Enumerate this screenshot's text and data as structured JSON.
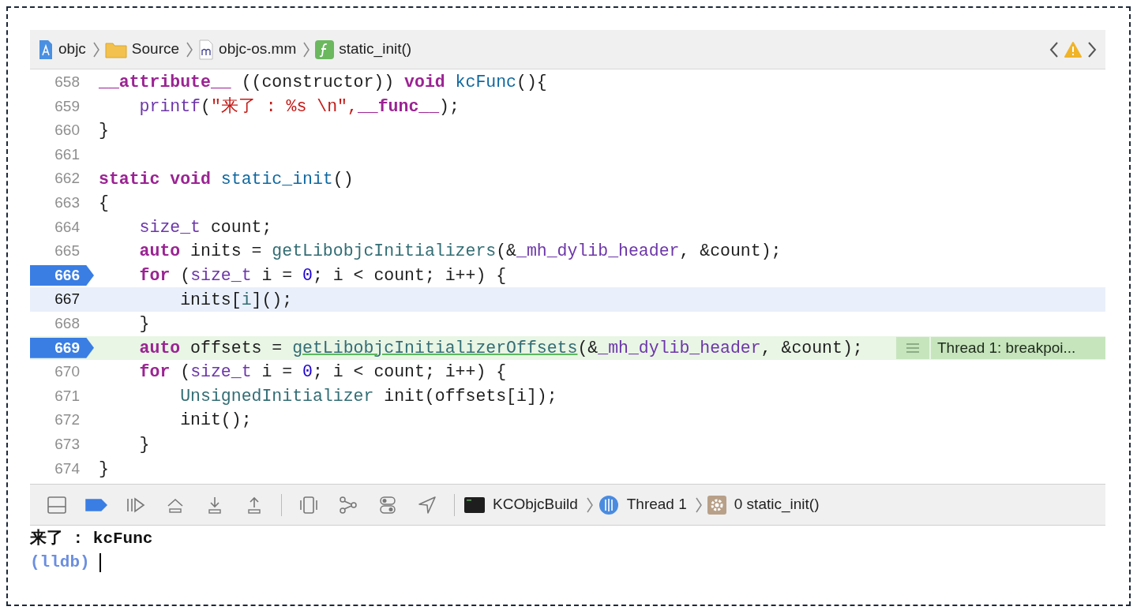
{
  "breadcrumbs": [
    {
      "kind": "project",
      "label": "objc"
    },
    {
      "kind": "folder",
      "label": "Source"
    },
    {
      "kind": "file",
      "label": "objc-os.mm"
    },
    {
      "kind": "function",
      "label": "static_init()"
    }
  ],
  "editor": {
    "lines": [
      {
        "number": "658",
        "breakpoint": false,
        "current": false,
        "cursor": false,
        "tokens": [
          {
            "t": "__attribute__",
            "kind": "kw"
          },
          {
            "t": " ((constructor)) ",
            "kind": "plain"
          },
          {
            "t": "void",
            "kind": "kw"
          },
          {
            "t": " kcFunc",
            "kind": "decl"
          },
          {
            "t": "(){",
            "kind": "plain"
          }
        ]
      },
      {
        "number": "659",
        "breakpoint": false,
        "current": false,
        "cursor": false,
        "tokens": [
          {
            "t": "    printf",
            "kind": "sysfunc"
          },
          {
            "t": "(",
            "kind": "plain"
          },
          {
            "t": "\"来了 : %s \\n\",",
            "kind": "str"
          },
          {
            "t": "__func__",
            "kind": "kw"
          },
          {
            "t": ");",
            "kind": "plain"
          }
        ]
      },
      {
        "number": "660",
        "breakpoint": false,
        "current": false,
        "cursor": false,
        "tokens": [
          {
            "t": "}",
            "kind": "plain"
          }
        ]
      },
      {
        "number": "661",
        "breakpoint": false,
        "current": false,
        "cursor": false
      },
      {
        "number": "662",
        "breakpoint": false,
        "current": false,
        "cursor": false,
        "tokens": [
          {
            "t": "static void",
            "kind": "kw"
          },
          {
            "t": " static_init",
            "kind": "decl"
          },
          {
            "t": "()",
            "kind": "plain"
          }
        ]
      },
      {
        "number": "663",
        "breakpoint": false,
        "current": false,
        "cursor": false,
        "tokens": [
          {
            "t": "{",
            "kind": "plain"
          }
        ]
      },
      {
        "number": "664",
        "breakpoint": false,
        "current": false,
        "cursor": false,
        "tokens": [
          {
            "t": "    size_t",
            "kind": "type"
          },
          {
            "t": " count;",
            "kind": "plain"
          }
        ]
      },
      {
        "number": "665",
        "breakpoint": false,
        "current": false,
        "cursor": false,
        "tokens": [
          {
            "t": "    auto",
            "kind": "kw"
          },
          {
            "t": " inits = ",
            "kind": "plain"
          },
          {
            "t": "getLibobjcInitializers",
            "kind": "func"
          },
          {
            "t": "(&",
            "kind": "plain"
          },
          {
            "t": "_mh_dylib_header",
            "kind": "var"
          },
          {
            "t": ", &count);",
            "kind": "plain"
          }
        ]
      },
      {
        "number": "666",
        "breakpoint": true,
        "current": false,
        "cursor": false,
        "tokens": [
          {
            "t": "    for",
            "kind": "kw"
          },
          {
            "t": " (",
            "kind": "plain"
          },
          {
            "t": "size_t",
            "kind": "type"
          },
          {
            "t": " i = ",
            "kind": "plain"
          },
          {
            "t": "0",
            "kind": "num"
          },
          {
            "t": "; i < count; i++) {",
            "kind": "plain"
          }
        ]
      },
      {
        "number": "667",
        "breakpoint": false,
        "current": false,
        "cursor": true,
        "tokens": [
          {
            "t": "        inits[",
            "kind": "plain"
          },
          {
            "t": "i",
            "kind": "func"
          },
          {
            "t": "]();",
            "kind": "plain"
          }
        ]
      },
      {
        "number": "668",
        "breakpoint": false,
        "current": false,
        "cursor": false,
        "tokens": [
          {
            "t": "    }",
            "kind": "plain"
          }
        ]
      },
      {
        "number": "669",
        "breakpoint": true,
        "current": true,
        "cursor": false,
        "tokens": [
          {
            "t": "    auto",
            "kind": "kw"
          },
          {
            "t": " offsets = ",
            "kind": "plain"
          },
          {
            "t": "getLibobjcInitializerOffsets",
            "kind": "link"
          },
          {
            "t": "(&",
            "kind": "plain"
          },
          {
            "t": "_mh_dylib_header",
            "kind": "var"
          },
          {
            "t": ", &count);",
            "kind": "plain"
          }
        ],
        "annotation": "Thread 1: breakpoi..."
      },
      {
        "number": "670",
        "breakpoint": false,
        "current": false,
        "cursor": false,
        "tokens": [
          {
            "t": "    for",
            "kind": "kw"
          },
          {
            "t": " (",
            "kind": "plain"
          },
          {
            "t": "size_t",
            "kind": "type"
          },
          {
            "t": " i = ",
            "kind": "plain"
          },
          {
            "t": "0",
            "kind": "num"
          },
          {
            "t": "; i < count; i++) {",
            "kind": "plain"
          }
        ]
      },
      {
        "number": "671",
        "breakpoint": false,
        "current": false,
        "cursor": false,
        "tokens": [
          {
            "t": "        UnsignedInitializer",
            "kind": "func"
          },
          {
            "t": " init(offsets[i]);",
            "kind": "plain"
          }
        ]
      },
      {
        "number": "672",
        "breakpoint": false,
        "current": false,
        "cursor": false,
        "tokens": [
          {
            "t": "        init();",
            "kind": "plain"
          }
        ]
      },
      {
        "number": "673",
        "breakpoint": false,
        "current": false,
        "cursor": false,
        "tokens": [
          {
            "t": "    }",
            "kind": "plain"
          }
        ]
      },
      {
        "number": "674",
        "breakpoint": false,
        "current": false,
        "cursor": false,
        "tokens": [
          {
            "t": "}",
            "kind": "plain"
          }
        ]
      }
    ]
  },
  "debug_bar": {
    "breakpoints_active": true,
    "path": [
      {
        "kind": "process",
        "label": "KCObjcBuild"
      },
      {
        "kind": "thread",
        "label": "Thread 1"
      },
      {
        "kind": "frame",
        "label": "0 static_init()"
      }
    ]
  },
  "console": {
    "lines": [
      {
        "kind": "output",
        "text": "来了 : kcFunc"
      },
      {
        "kind": "prompt",
        "text": "(lldb)"
      }
    ]
  }
}
